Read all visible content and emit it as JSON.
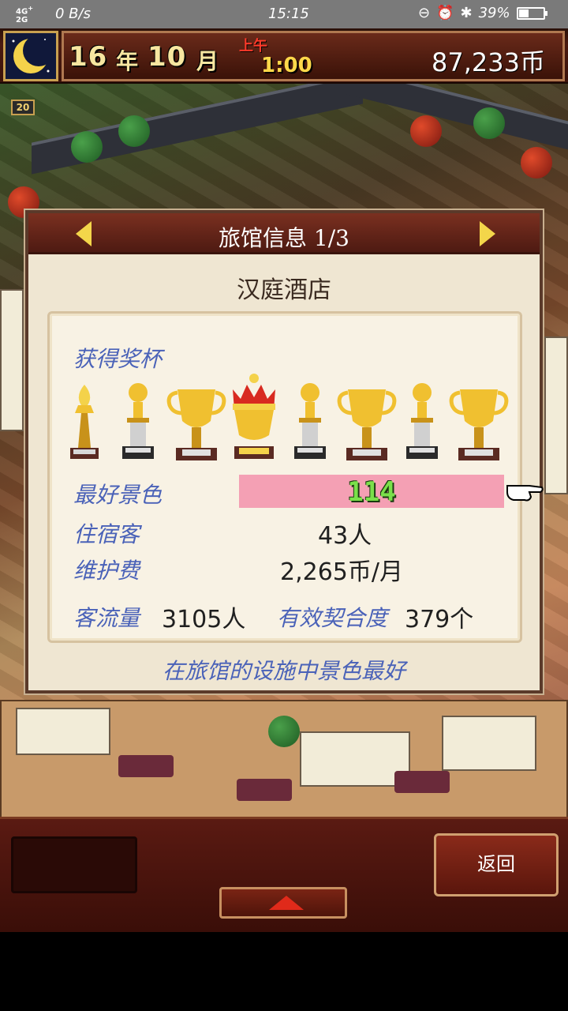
{
  "status_bar": {
    "network": "4G⁺\n2G",
    "speed": "0 B/s",
    "time": "15:15",
    "battery_percent": "39%",
    "icons": [
      "lock-rotation-icon",
      "alarm-icon",
      "bluetooth-icon",
      "battery-icon"
    ]
  },
  "header": {
    "year_num": "16",
    "year_unit": "年",
    "month_num": "10",
    "month_unit": "月",
    "ampm": "上午",
    "clock": "1:00",
    "coins": "87,233币"
  },
  "scene": {
    "level_badge": "20"
  },
  "dialog": {
    "title": "旅馆信息 1/3",
    "hotel_name": "汉庭酒店",
    "awards_label": "获得奖杯",
    "trophy_count": 8,
    "best_scenery_label": "最好景色",
    "best_scenery_value": "114",
    "guests_label": "住宿客",
    "guests_value": "43人",
    "maintenance_label": "维护费",
    "maintenance_value": "2,265币/月",
    "traffic_label": "客流量",
    "traffic_value": "3105人",
    "contracts_label": "有效契合度",
    "contracts_value": "379个",
    "footer": "在旅馆的设施中景色最好"
  },
  "bottom": {
    "back_label": "返回"
  },
  "colors": {
    "accent_blue": "#4a62b8",
    "highlight_pink": "#f4a0b4",
    "value_green": "#7ae04a"
  }
}
